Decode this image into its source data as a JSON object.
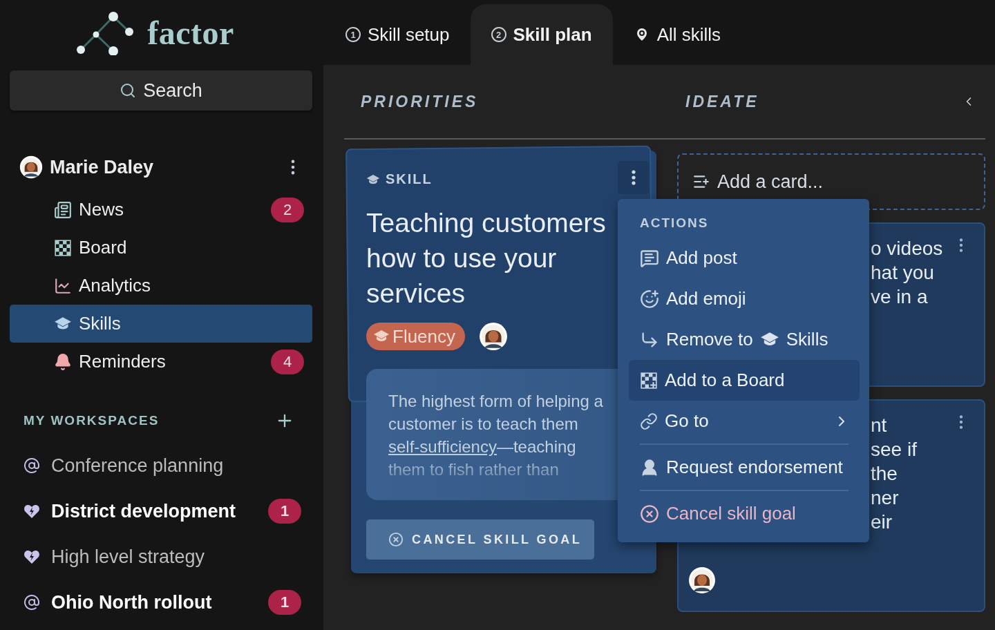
{
  "logo": {
    "text": "factor"
  },
  "tabs": [
    {
      "label": "Skill setup",
      "kind": "step",
      "number": "1",
      "selected": false
    },
    {
      "label": "Skill plan",
      "kind": "step",
      "number": "2",
      "selected": true
    },
    {
      "label": "All skills",
      "kind": "pin",
      "selected": false
    }
  ],
  "search": {
    "placeholder": "Search"
  },
  "user": {
    "name": "Marie Daley"
  },
  "nav": [
    {
      "label": "News",
      "kind": "news",
      "badge": "2",
      "selected": false
    },
    {
      "label": "Board",
      "kind": "board",
      "selected": false
    },
    {
      "label": "Analytics",
      "kind": "chart",
      "selected": false
    },
    {
      "label": "Skills",
      "kind": "skills",
      "selected": true
    },
    {
      "label": "Reminders",
      "kind": "bell",
      "badge": "4",
      "selected": false
    }
  ],
  "workspaces": {
    "title": "MY WORKSPACES",
    "items": [
      {
        "label": "Conference planning",
        "kind": "at",
        "unread": false
      },
      {
        "label": "District development",
        "kind": "heart",
        "unread": true,
        "badge": "1"
      },
      {
        "label": "High level strategy",
        "kind": "heart",
        "unread": false
      },
      {
        "label": "Ohio North rollout",
        "kind": "at",
        "unread": true,
        "badge": "1"
      }
    ]
  },
  "columns": [
    {
      "title": "PRIORITIES"
    },
    {
      "title": "IDEATE"
    }
  ],
  "skill_card": {
    "type_label": "SKILL",
    "title": "Teaching customers how to use your services",
    "tag": "Fluency",
    "quote": {
      "before": "The highest form of helping a customer is to teach them ",
      "link": "self-sufficiency",
      "after": "—teaching them to fish rather than"
    },
    "button": "CANCEL SKILL GOAL"
  },
  "ideate": {
    "add_card": "Add a card...",
    "cards": [
      {
        "lines": [
          "o videos",
          "hat you",
          "ve in a"
        ]
      },
      {
        "lines": [
          "nt",
          "see if",
          "the",
          "ner",
          "eir"
        ],
        "avatar": true
      }
    ]
  },
  "menu": {
    "title": "ACTIONS",
    "items": [
      {
        "kind": "post",
        "label": "Add post",
        "selected": false
      },
      {
        "kind": "emoji",
        "label": "Add emoji",
        "selected": false
      },
      {
        "kind": "move",
        "label": "Remove to",
        "target": "Skills",
        "selected": false
      },
      {
        "kind": "board",
        "label": "Add to a Board",
        "selected": true
      },
      {
        "kind": "goto",
        "label": "Go to",
        "submenu": true,
        "selected": false
      },
      {
        "kind": "endorse",
        "label": "Request endorsement",
        "divider_before": true,
        "selected": false
      },
      {
        "kind": "cancel",
        "label": "Cancel skill goal",
        "divider_before": true,
        "danger": true,
        "selected": false
      }
    ]
  }
}
